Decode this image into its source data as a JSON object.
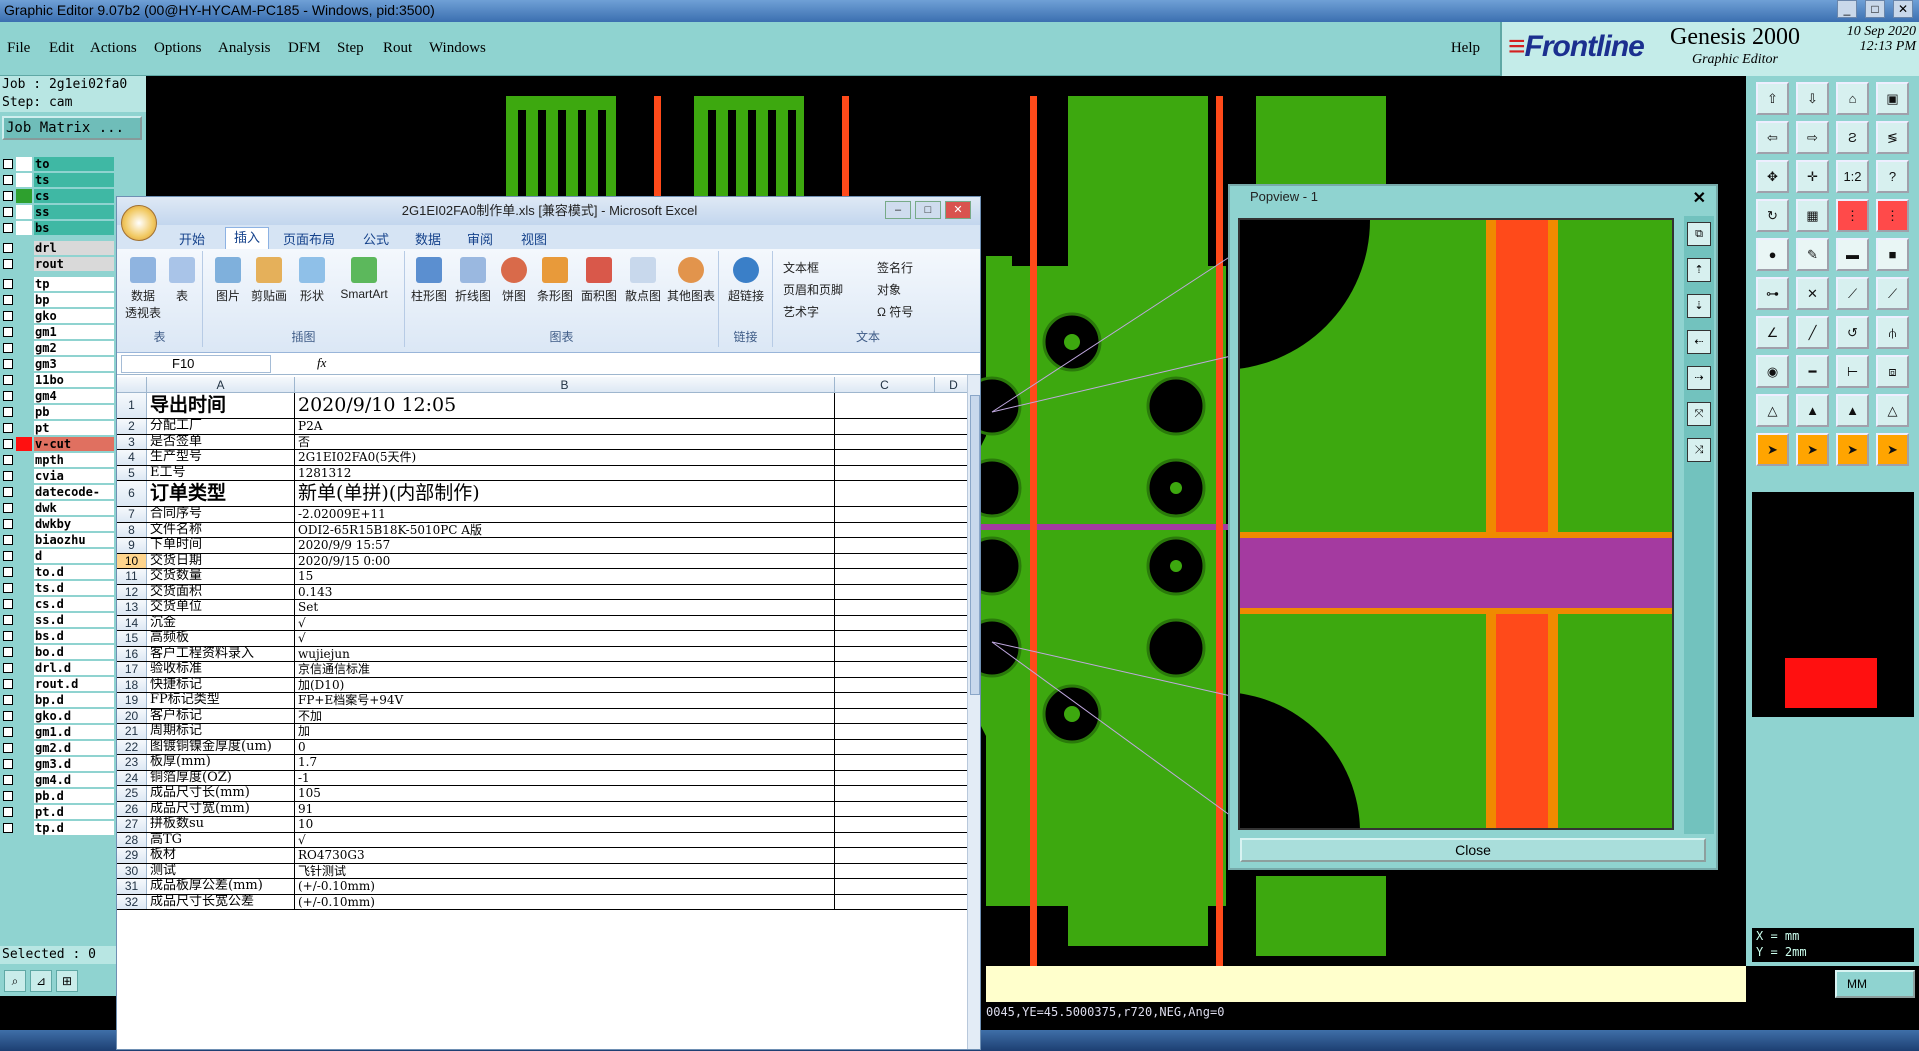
{
  "window": {
    "title": "Graphic Editor 9.07b2 (00@HY-HYCAM-PC185 - Windows, pid:3500)"
  },
  "menu": [
    "File",
    "Edit",
    "Actions",
    "Options",
    "Analysis",
    "DFM",
    "Step",
    "Rout",
    "Windows"
  ],
  "help_label": "Help",
  "brand": {
    "logo": "Frontline",
    "product": "Genesis 2000",
    "subtitle": "Graphic Editor",
    "date": "10 Sep 2020",
    "time": "12:13 PM"
  },
  "left": {
    "job": "Job : 2g1ei02fa0",
    "step": "Step: cam",
    "job_matrix": "Job Matrix ...",
    "selected": "Selected : 0",
    "layers": [
      {
        "name": "to",
        "color": "#ffffff",
        "kind": "board"
      },
      {
        "name": "ts",
        "color": "#ffffff",
        "kind": "board"
      },
      {
        "name": "cs",
        "color": "#2ea02e",
        "kind": "board"
      },
      {
        "name": "ss",
        "color": "#ffffff",
        "kind": "board"
      },
      {
        "name": "bs",
        "color": "#ffffff",
        "kind": "board"
      },
      {
        "name": "drl",
        "color": "",
        "kind": "drl"
      },
      {
        "name": "rout",
        "color": "",
        "kind": "drl"
      },
      {
        "name": "tp",
        "color": "",
        "kind": "plain"
      },
      {
        "name": "bp",
        "color": "",
        "kind": "plain"
      },
      {
        "name": "gko",
        "color": "",
        "kind": "plain"
      },
      {
        "name": "gm1",
        "color": "",
        "kind": "plain"
      },
      {
        "name": "gm2",
        "color": "",
        "kind": "plain"
      },
      {
        "name": "gm3",
        "color": "",
        "kind": "plain"
      },
      {
        "name": "11bo",
        "color": "",
        "kind": "plain"
      },
      {
        "name": "gm4",
        "color": "",
        "kind": "plain"
      },
      {
        "name": "pb",
        "color": "",
        "kind": "plain"
      },
      {
        "name": "pt",
        "color": "",
        "kind": "plain"
      },
      {
        "name": "v-cut",
        "color": "#ff1010",
        "kind": "sel"
      },
      {
        "name": "mpth",
        "color": "",
        "kind": "plain"
      },
      {
        "name": "cvia",
        "color": "",
        "kind": "plain"
      },
      {
        "name": "datecode-pt",
        "color": "",
        "kind": "plain"
      },
      {
        "name": "dwk",
        "color": "",
        "kind": "plain"
      },
      {
        "name": "dwkby",
        "color": "",
        "kind": "plain"
      },
      {
        "name": "biaozhu",
        "color": "",
        "kind": "plain"
      },
      {
        "name": "d",
        "color": "",
        "kind": "plain"
      },
      {
        "name": "to.d",
        "color": "",
        "kind": "plain"
      },
      {
        "name": "ts.d",
        "color": "",
        "kind": "plain"
      },
      {
        "name": "cs.d",
        "color": "",
        "kind": "plain"
      },
      {
        "name": "ss.d",
        "color": "",
        "kind": "plain"
      },
      {
        "name": "bs.d",
        "color": "",
        "kind": "plain"
      },
      {
        "name": "bo.d",
        "color": "",
        "kind": "plain"
      },
      {
        "name": "drl.d",
        "color": "",
        "kind": "plain"
      },
      {
        "name": "rout.d",
        "color": "",
        "kind": "plain"
      },
      {
        "name": "bp.d",
        "color": "",
        "kind": "plain"
      },
      {
        "name": "gko.d",
        "color": "",
        "kind": "plain"
      },
      {
        "name": "gm1.d",
        "color": "",
        "kind": "plain"
      },
      {
        "name": "gm2.d",
        "color": "",
        "kind": "plain"
      },
      {
        "name": "gm3.d",
        "color": "",
        "kind": "plain"
      },
      {
        "name": "gm4.d",
        "color": "",
        "kind": "plain"
      },
      {
        "name": "pb.d",
        "color": "",
        "kind": "plain"
      },
      {
        "name": "pt.d",
        "color": "",
        "kind": "plain"
      },
      {
        "name": "tp.d",
        "color": "",
        "kind": "plain"
      }
    ]
  },
  "popview": {
    "title": "Popview - 1",
    "close_label": "Close"
  },
  "status": {
    "coords_line": "0045,YE=45.5000375,r720,NEG,Ang=0",
    "units": "MM",
    "x_label": "X =",
    "y_label": "Y =",
    "x_value": "mm",
    "y_value": "2mm"
  },
  "excel": {
    "title": "2G1EI02FA0制作单.xls  [兼容模式] - Microsoft Excel",
    "tabs": [
      "开始",
      "插入",
      "页面布局",
      "公式",
      "数据",
      "审阅",
      "视图"
    ],
    "active_tab": "插入",
    "ribbon_groups": {
      "tables": {
        "label": "表",
        "buttons": [
          "数据\n透视表",
          "表"
        ]
      },
      "illustrations": {
        "label": "插图",
        "buttons": [
          "图片",
          "剪贴画",
          "形状",
          "SmartArt"
        ]
      },
      "charts": {
        "label": "图表",
        "buttons": [
          "柱形图",
          "折线图",
          "饼图",
          "条形图",
          "面积图",
          "散点图",
          "其他图表"
        ]
      },
      "links": {
        "label": "链接",
        "buttons": [
          "超链接"
        ]
      },
      "text": {
        "label": "文本",
        "small": [
          "文本框",
          "页眉和页脚",
          "艺术字",
          "签名行",
          "对象",
          "Ω 符号"
        ]
      }
    },
    "name_box": "F10",
    "columns": [
      "A",
      "B",
      "C",
      "D"
    ],
    "rows": [
      {
        "n": "1",
        "a": "导出时间",
        "b": "2020/9/10 12:05",
        "big": true
      },
      {
        "n": "2",
        "a": "分配工厂",
        "b": "P2A"
      },
      {
        "n": "3",
        "a": "是否签单",
        "b": "否"
      },
      {
        "n": "4",
        "a": "生产型号",
        "b": "2G1EI02FA0(5天件)"
      },
      {
        "n": "5",
        "a": "E工号",
        "b": "1281312"
      },
      {
        "n": "6",
        "a": "订单类型",
        "b": "新单(单拼)(内部制作)",
        "big": true
      },
      {
        "n": "7",
        "a": "合同序号",
        "b": "-2.02009E+11"
      },
      {
        "n": "8",
        "a": "文件名称",
        "b": "ODI2-65R15B18K-5010PC A版"
      },
      {
        "n": "9",
        "a": "下单时间",
        "b": "2020/9/9 15:57"
      },
      {
        "n": "10",
        "a": "交货日期",
        "b": "2020/9/15 0:00",
        "sel": true
      },
      {
        "n": "11",
        "a": "交货数量",
        "b": "15"
      },
      {
        "n": "12",
        "a": "交货面积",
        "b": "0.143"
      },
      {
        "n": "13",
        "a": "交货单位",
        "b": "Set"
      },
      {
        "n": "14",
        "a": "沉金",
        "b": "√"
      },
      {
        "n": "15",
        "a": "高频板",
        "b": "√"
      },
      {
        "n": "16",
        "a": "客户工程资料录入",
        "b": "wujiejun"
      },
      {
        "n": "17",
        "a": "验收标准",
        "b": "京信通信标准"
      },
      {
        "n": "18",
        "a": "快捷标记",
        "b": "加(D10)"
      },
      {
        "n": "19",
        "a": "FP标记类型",
        "b": "FP+E档案号+94V"
      },
      {
        "n": "20",
        "a": "客户标记",
        "b": "不加"
      },
      {
        "n": "21",
        "a": "周期标记",
        "b": "加"
      },
      {
        "n": "22",
        "a": "图镀铜镍金厚度(um)",
        "b": "0"
      },
      {
        "n": "23",
        "a": "板厚(mm)",
        "b": "1.7"
      },
      {
        "n": "24",
        "a": "铜箔厚度(OZ)",
        "b": "-1"
      },
      {
        "n": "25",
        "a": "成品尺寸长(mm)",
        "b": "105"
      },
      {
        "n": "26",
        "a": "成品尺寸宽(mm)",
        "b": "91"
      },
      {
        "n": "27",
        "a": "拼板数su",
        "b": "10"
      },
      {
        "n": "28",
        "a": "高TG",
        "b": "√"
      },
      {
        "n": "29",
        "a": "板材",
        "b": "RO4730G3"
      },
      {
        "n": "30",
        "a": "测试",
        "b": "飞针测试"
      },
      {
        "n": "31",
        "a": "成品板厚公差(mm)",
        "b": "(+/-0.10mm)"
      },
      {
        "n": "32",
        "a": "成品尺寸长宽公差",
        "b": "(+/-0.10mm)"
      }
    ]
  }
}
